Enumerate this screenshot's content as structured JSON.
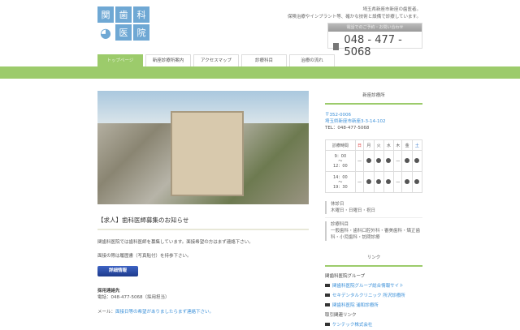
{
  "header": {
    "logo_chars": [
      "関",
      "歯",
      "科",
      "医",
      "院"
    ],
    "tagline1": "埼玉県新座市新座の歯医者。",
    "tagline2": "保険治療やインプラント等、確かな技術と設備で診療しています。",
    "phone_label": "電話でのご予約・お問い合わせ",
    "phone": "048 - 477 - 5068"
  },
  "nav": [
    "トップページ",
    "新座診療所案内",
    "アクセスマップ",
    "診療科目",
    "治療の流れ"
  ],
  "main": {
    "title": "【求人】歯科医師募集のお知らせ",
    "p1": "関歯科医院では歯科医師を募集しています。面接希望の方はまず連絡下さい。",
    "p2": "面接の際は履歴書（写真貼付）を持参下さい。",
    "button": "詳細情報",
    "contact_heading": "採用連絡先",
    "contact_tel": "電話：048-477-5068（採用担当）",
    "mail_label": "メール：",
    "mail_link": "面接日等の希望がありましたらまず連絡下さい。"
  },
  "sidebar": {
    "clinic_heading": "新座診療所",
    "zip": "〒352-0006",
    "address": "埼玉県新座市新座3-3-14-102",
    "tel": "TEL：048-477-5068",
    "hours": {
      "header": [
        "診療時間",
        "日",
        "月",
        "火",
        "水",
        "木",
        "金",
        "土"
      ],
      "rows": [
        {
          "time1": "9：00",
          "time2": "〜",
          "time3": "12：00",
          "cells": [
            "—",
            "●",
            "●",
            "●",
            "—",
            "●",
            "●"
          ]
        },
        {
          "time1": "14：00",
          "time2": "〜",
          "time3": "19：30",
          "cells": [
            "—",
            "●",
            "●",
            "●",
            "—",
            "●",
            "●"
          ]
        }
      ]
    },
    "closed_label": "休診日",
    "closed": "木曜日・日曜日・祝日",
    "dept_label": "診療科目",
    "dept": "一般歯科・歯科口腔外科・審美歯科・矯正歯科・小児歯科・訪問診療",
    "links_heading": "リンク",
    "group_heading": "関歯科医院グループ",
    "group_links": [
      "関歯科医院グループ総合情報サイト",
      "セキデンタルクリニック 所沢診療所",
      "関歯科医院 浦和診療所"
    ],
    "trade_heading": "取引関連リンク",
    "trade_links": [
      "ケンテック株式会社"
    ]
  }
}
